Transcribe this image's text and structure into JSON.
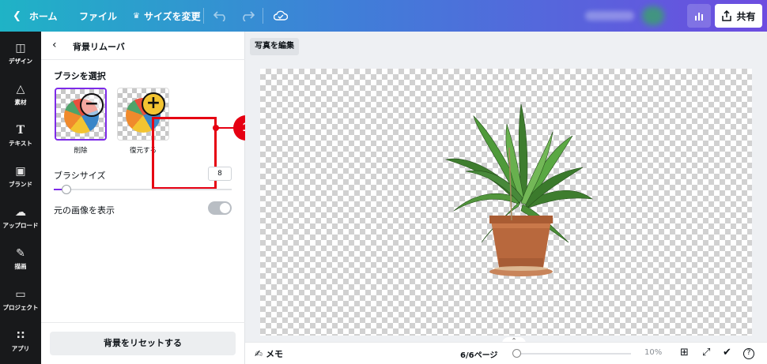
{
  "topbar": {
    "home_label": "ホーム",
    "file_label": "ファイル",
    "resize_label": "サイズを変更",
    "share_label": "共有",
    "icons": [
      "chevron-left-icon",
      "crown-icon",
      "undo-icon",
      "redo-icon",
      "cloud-check-icon",
      "stats-icon",
      "share-upload-icon"
    ]
  },
  "sidebar": {
    "items": [
      {
        "label": "デザイン",
        "icon": "layout-icon"
      },
      {
        "label": "素材",
        "icon": "shapes-icon"
      },
      {
        "label": "テキスト",
        "icon": "text-icon"
      },
      {
        "label": "ブランド",
        "icon": "brand-icon"
      },
      {
        "label": "アップロード",
        "icon": "upload-icon"
      },
      {
        "label": "描画",
        "icon": "draw-icon"
      },
      {
        "label": "プロジェクト",
        "icon": "folder-icon"
      },
      {
        "label": "アプリ",
        "icon": "apps-icon"
      }
    ]
  },
  "panel": {
    "title": "背景リムーバ",
    "brush_section": "ブラシを選択",
    "brushes": [
      {
        "label": "削除",
        "selected": true
      },
      {
        "label": "復元する",
        "selected": false
      }
    ],
    "callout_number": "1",
    "brush_size_label": "ブラシサイズ",
    "brush_size_value": "8",
    "brush_size_fraction": 0.07,
    "show_original_label": "元の画像を表示",
    "show_original_on": false,
    "reset_label": "背景をリセットする"
  },
  "canvas": {
    "edit_photo_label": "写真を編集"
  },
  "bottombar": {
    "memo_label": "メモ",
    "pages": "6/6ページ",
    "zoom": "10%"
  },
  "colors": {
    "accent": "#7d2ae8",
    "highlight": "#e60012"
  }
}
